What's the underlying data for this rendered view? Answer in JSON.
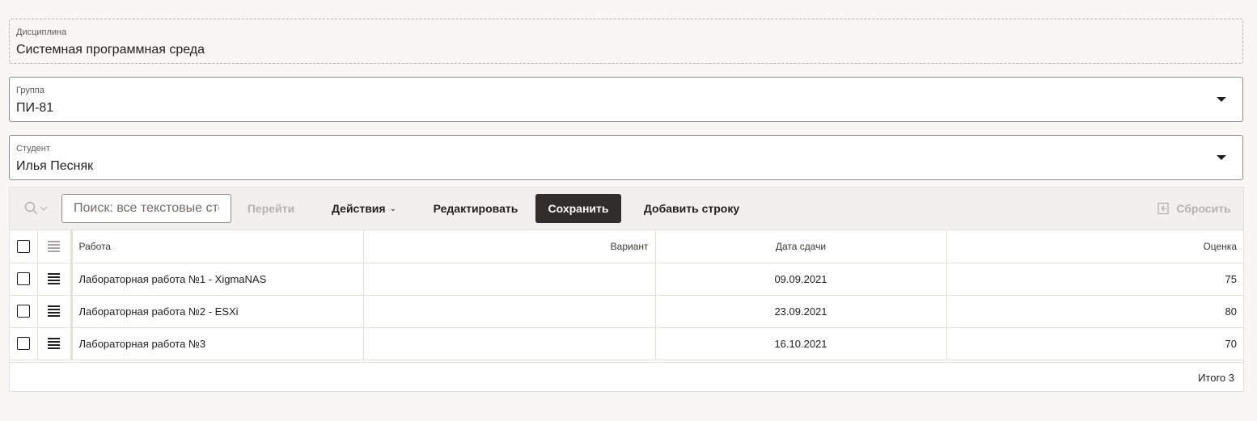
{
  "discipline": {
    "label": "Дисциплина",
    "value": "Системная программная среда"
  },
  "group": {
    "label": "Группа",
    "value": "ПИ-81"
  },
  "student": {
    "label": "Студент",
    "value": "Илья Песняк"
  },
  "toolbar": {
    "search_icon": "search-icon",
    "search_placeholder": "Поиск: все текстовые столбцы",
    "go_label": "Перейти",
    "actions_label": "Действия",
    "edit_label": "Редактировать",
    "save_label": "Сохранить",
    "add_row_label": "Добавить строку",
    "reset_label": "Сбросить"
  },
  "grid": {
    "columns": [
      "Работа",
      "Вариант",
      "Дата сдачи",
      "Оценка"
    ],
    "rows": [
      {
        "work": "Лабораторная работа №1 - XigmaNAS",
        "variant": "",
        "date": "09.09.2021",
        "grade": "75"
      },
      {
        "work": "Лабораторная работа №2 - ESXi",
        "variant": "",
        "date": "23.09.2021",
        "grade": "80"
      },
      {
        "work": "Лабораторная работа №3",
        "variant": "",
        "date": "16.10.2021",
        "grade": "70"
      }
    ],
    "total": "Итого 3"
  },
  "colors": {
    "primary_button": "#312d2a",
    "background": "#f8f7f5"
  }
}
